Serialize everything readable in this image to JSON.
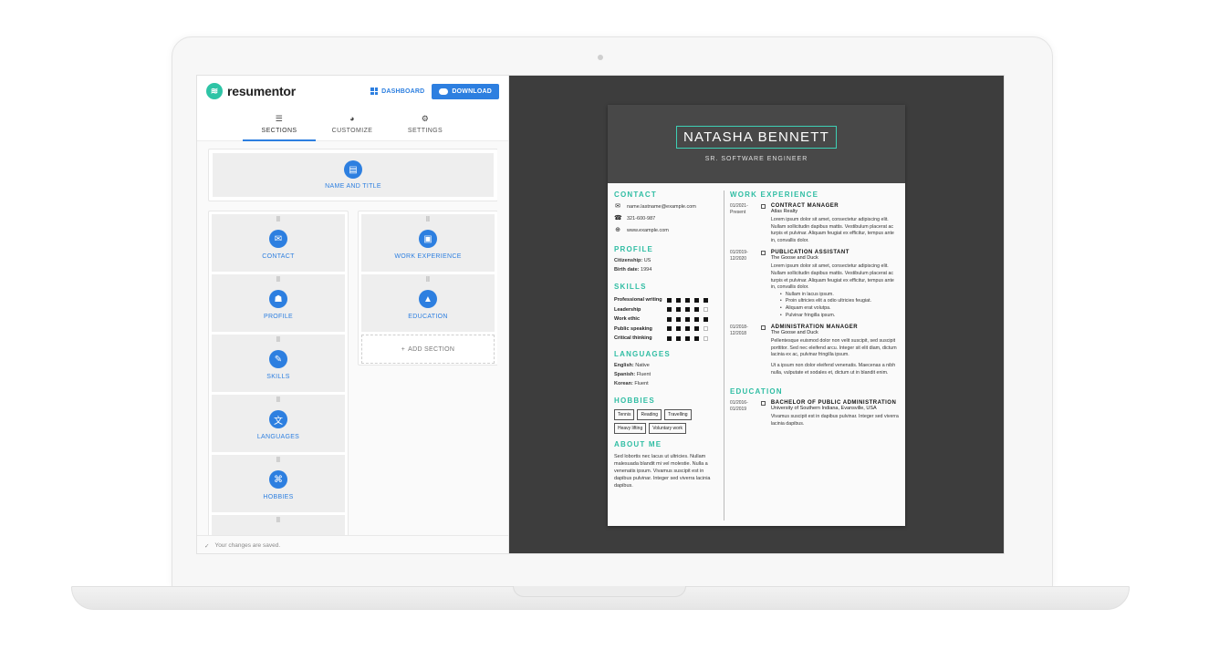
{
  "app": {
    "logo_text": "resumentor",
    "dashboard_label": "DASHBOARD",
    "download_label": "DOWNLOAD"
  },
  "tabs": [
    {
      "label": "SECTIONS",
      "icon": "list-icon",
      "active": true
    },
    {
      "label": "CUSTOMIZE",
      "icon": "palette-icon",
      "active": false
    },
    {
      "label": "SETTINGS",
      "icon": "gear-icon",
      "active": false
    }
  ],
  "sections": {
    "top": {
      "label": "NAME AND TITLE",
      "icon": "id-card-icon"
    },
    "left": [
      {
        "label": "CONTACT",
        "icon": "mail-icon"
      },
      {
        "label": "PROFILE",
        "icon": "badge-icon"
      },
      {
        "label": "SKILLS",
        "icon": "wrench-icon"
      },
      {
        "label": "LANGUAGES",
        "icon": "translate-icon"
      },
      {
        "label": "HOBBIES",
        "icon": "gamepad-icon"
      }
    ],
    "right": [
      {
        "label": "WORK EXPERIENCE",
        "icon": "briefcase-icon"
      },
      {
        "label": "EDUCATION",
        "icon": "graduation-cap-icon"
      }
    ],
    "add_label": "ADD SECTION"
  },
  "status": {
    "saved": "Your changes are saved."
  },
  "colors": {
    "accent": "#2d7fe0",
    "teal": "#2fbda3",
    "header_bg": "#484848",
    "preview_bg": "#3d3d3d"
  },
  "resume": {
    "name": "NATASHA BENNETT",
    "title": "SR. SOFTWARE ENGINEER",
    "headings": {
      "contact": "CONTACT",
      "profile": "PROFILE",
      "skills": "SKILLS",
      "languages": "LANGUAGES",
      "hobbies": "HOBBIES",
      "about": "ABOUT ME",
      "work": "WORK EXPERIENCE",
      "education": "EDUCATION"
    },
    "contact": {
      "email": "name.lastname@example.com",
      "phone": "321-600-987",
      "web": "www.example.com"
    },
    "profile": {
      "citizenship_label": "Citizenship:",
      "citizenship": "US",
      "birth_label": "Birth date:",
      "birth": "1994"
    },
    "skills": [
      {
        "name": "Professional writing",
        "level": 5
      },
      {
        "name": "Leadership",
        "level": 4
      },
      {
        "name": "Work ethic",
        "level": 5
      },
      {
        "name": "Public speaking",
        "level": 4
      },
      {
        "name": "Critical thinking",
        "level": 4
      }
    ],
    "languages": [
      {
        "label": "English:",
        "value": "Native"
      },
      {
        "label": "Spanish:",
        "value": "Fluent"
      },
      {
        "label": "Korean:",
        "value": "Fluent"
      }
    ],
    "hobbies": [
      "Tennis",
      "Reading",
      "Travelling",
      "Heavy lifting",
      "Voluntary work"
    ],
    "about": "Sed lobortis nec lacus ut ultricies. Nullam malesuada blandit mi vel molestie. Nulla a venenatis ipsum. Vivamus suscipit est in dapibus pulvinar. Integer sed viverra lacinia dapibus.",
    "work": [
      {
        "date1": "01/2021-",
        "date2": "Present",
        "title": "CONTRACT MANAGER",
        "company": "Atlas Realty",
        "desc": "Lorem ipsum dolor sit amet, consectetur adipiscing elit. Nullam sollicitudin dapibus mattis. Vestibulum placerat ac turpis et pulvinar. Aliquam feugiat ex efficitur, tempus ante in, convallis dolor."
      },
      {
        "date1": "01/2019-",
        "date2": "12/2020",
        "title": "PUBLICATION ASSISTANT",
        "company": "The Goose and Duck",
        "desc": "Lorem ipsum dolor sit amet, consectetur adipiscing elit. Nullam sollicitudin dapibus mattis. Vestibulum placerat ac turpis et pulvinar. Aliquam feugiat ex efficitur, tempus ante in, convallis dolor.",
        "bullets": [
          "Nullam in lacus ipsum.",
          "Proin ultricies elit a odio ultricies feugiat.",
          "Aliquam erat volutpa.",
          "Pulvinar fringilla ipsum."
        ]
      },
      {
        "date1": "01/2018-",
        "date2": "12/2018",
        "title": "ADMINISTRATION MANAGER",
        "company": "The Goose and Duck",
        "desc": "Pellentesque euismod dolor non velit suscipit, sed suscipit porttitor. Sed nec eleifend arcu. Integer sit elit diam, dictum lacinia ex ac, pulvinar fringilla ipsum.",
        "desc2": "Ut a ipsum non dolor eleifend venenatis. Maecenas a nibh nulla, vulputate et sodales et, dictum ut in blandit enim."
      }
    ],
    "education": [
      {
        "date1": "01/2016-",
        "date2": "01/2019",
        "title": "BACHELOR OF PUBLIC ADMINISTRATION",
        "company": "University of Southern Indiana, Evansville, USA",
        "desc": "Vivamus suscipit est in dapibus pulvinar. Integer sed viverra lacinia dapibus."
      }
    ]
  }
}
